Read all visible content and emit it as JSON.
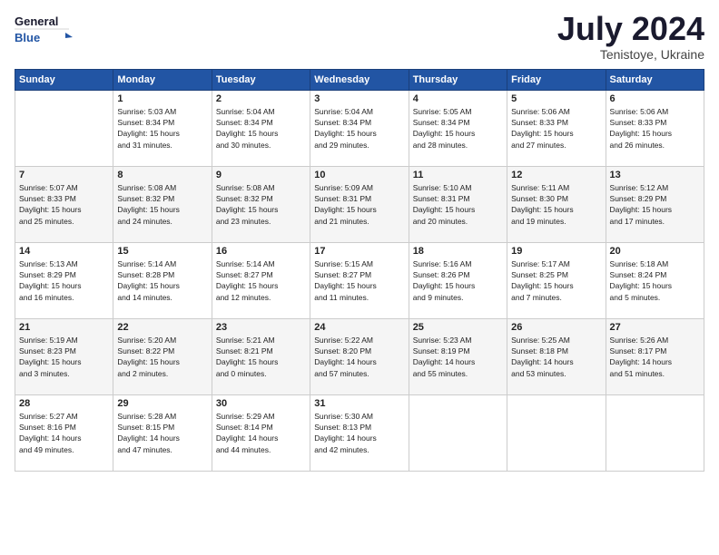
{
  "header": {
    "logo_line1": "General",
    "logo_line2": "Blue",
    "month": "July 2024",
    "location": "Tenistoye, Ukraine"
  },
  "days_of_week": [
    "Sunday",
    "Monday",
    "Tuesday",
    "Wednesday",
    "Thursday",
    "Friday",
    "Saturday"
  ],
  "weeks": [
    [
      {
        "day": "",
        "info": ""
      },
      {
        "day": "1",
        "info": "Sunrise: 5:03 AM\nSunset: 8:34 PM\nDaylight: 15 hours\nand 31 minutes."
      },
      {
        "day": "2",
        "info": "Sunrise: 5:04 AM\nSunset: 8:34 PM\nDaylight: 15 hours\nand 30 minutes."
      },
      {
        "day": "3",
        "info": "Sunrise: 5:04 AM\nSunset: 8:34 PM\nDaylight: 15 hours\nand 29 minutes."
      },
      {
        "day": "4",
        "info": "Sunrise: 5:05 AM\nSunset: 8:34 PM\nDaylight: 15 hours\nand 28 minutes."
      },
      {
        "day": "5",
        "info": "Sunrise: 5:06 AM\nSunset: 8:33 PM\nDaylight: 15 hours\nand 27 minutes."
      },
      {
        "day": "6",
        "info": "Sunrise: 5:06 AM\nSunset: 8:33 PM\nDaylight: 15 hours\nand 26 minutes."
      }
    ],
    [
      {
        "day": "7",
        "info": "Sunrise: 5:07 AM\nSunset: 8:33 PM\nDaylight: 15 hours\nand 25 minutes."
      },
      {
        "day": "8",
        "info": "Sunrise: 5:08 AM\nSunset: 8:32 PM\nDaylight: 15 hours\nand 24 minutes."
      },
      {
        "day": "9",
        "info": "Sunrise: 5:08 AM\nSunset: 8:32 PM\nDaylight: 15 hours\nand 23 minutes."
      },
      {
        "day": "10",
        "info": "Sunrise: 5:09 AM\nSunset: 8:31 PM\nDaylight: 15 hours\nand 21 minutes."
      },
      {
        "day": "11",
        "info": "Sunrise: 5:10 AM\nSunset: 8:31 PM\nDaylight: 15 hours\nand 20 minutes."
      },
      {
        "day": "12",
        "info": "Sunrise: 5:11 AM\nSunset: 8:30 PM\nDaylight: 15 hours\nand 19 minutes."
      },
      {
        "day": "13",
        "info": "Sunrise: 5:12 AM\nSunset: 8:29 PM\nDaylight: 15 hours\nand 17 minutes."
      }
    ],
    [
      {
        "day": "14",
        "info": "Sunrise: 5:13 AM\nSunset: 8:29 PM\nDaylight: 15 hours\nand 16 minutes."
      },
      {
        "day": "15",
        "info": "Sunrise: 5:14 AM\nSunset: 8:28 PM\nDaylight: 15 hours\nand 14 minutes."
      },
      {
        "day": "16",
        "info": "Sunrise: 5:14 AM\nSunset: 8:27 PM\nDaylight: 15 hours\nand 12 minutes."
      },
      {
        "day": "17",
        "info": "Sunrise: 5:15 AM\nSunset: 8:27 PM\nDaylight: 15 hours\nand 11 minutes."
      },
      {
        "day": "18",
        "info": "Sunrise: 5:16 AM\nSunset: 8:26 PM\nDaylight: 15 hours\nand 9 minutes."
      },
      {
        "day": "19",
        "info": "Sunrise: 5:17 AM\nSunset: 8:25 PM\nDaylight: 15 hours\nand 7 minutes."
      },
      {
        "day": "20",
        "info": "Sunrise: 5:18 AM\nSunset: 8:24 PM\nDaylight: 15 hours\nand 5 minutes."
      }
    ],
    [
      {
        "day": "21",
        "info": "Sunrise: 5:19 AM\nSunset: 8:23 PM\nDaylight: 15 hours\nand 3 minutes."
      },
      {
        "day": "22",
        "info": "Sunrise: 5:20 AM\nSunset: 8:22 PM\nDaylight: 15 hours\nand 2 minutes."
      },
      {
        "day": "23",
        "info": "Sunrise: 5:21 AM\nSunset: 8:21 PM\nDaylight: 15 hours\nand 0 minutes."
      },
      {
        "day": "24",
        "info": "Sunrise: 5:22 AM\nSunset: 8:20 PM\nDaylight: 14 hours\nand 57 minutes."
      },
      {
        "day": "25",
        "info": "Sunrise: 5:23 AM\nSunset: 8:19 PM\nDaylight: 14 hours\nand 55 minutes."
      },
      {
        "day": "26",
        "info": "Sunrise: 5:25 AM\nSunset: 8:18 PM\nDaylight: 14 hours\nand 53 minutes."
      },
      {
        "day": "27",
        "info": "Sunrise: 5:26 AM\nSunset: 8:17 PM\nDaylight: 14 hours\nand 51 minutes."
      }
    ],
    [
      {
        "day": "28",
        "info": "Sunrise: 5:27 AM\nSunset: 8:16 PM\nDaylight: 14 hours\nand 49 minutes."
      },
      {
        "day": "29",
        "info": "Sunrise: 5:28 AM\nSunset: 8:15 PM\nDaylight: 14 hours\nand 47 minutes."
      },
      {
        "day": "30",
        "info": "Sunrise: 5:29 AM\nSunset: 8:14 PM\nDaylight: 14 hours\nand 44 minutes."
      },
      {
        "day": "31",
        "info": "Sunrise: 5:30 AM\nSunset: 8:13 PM\nDaylight: 14 hours\nand 42 minutes."
      },
      {
        "day": "",
        "info": ""
      },
      {
        "day": "",
        "info": ""
      },
      {
        "day": "",
        "info": ""
      }
    ]
  ]
}
